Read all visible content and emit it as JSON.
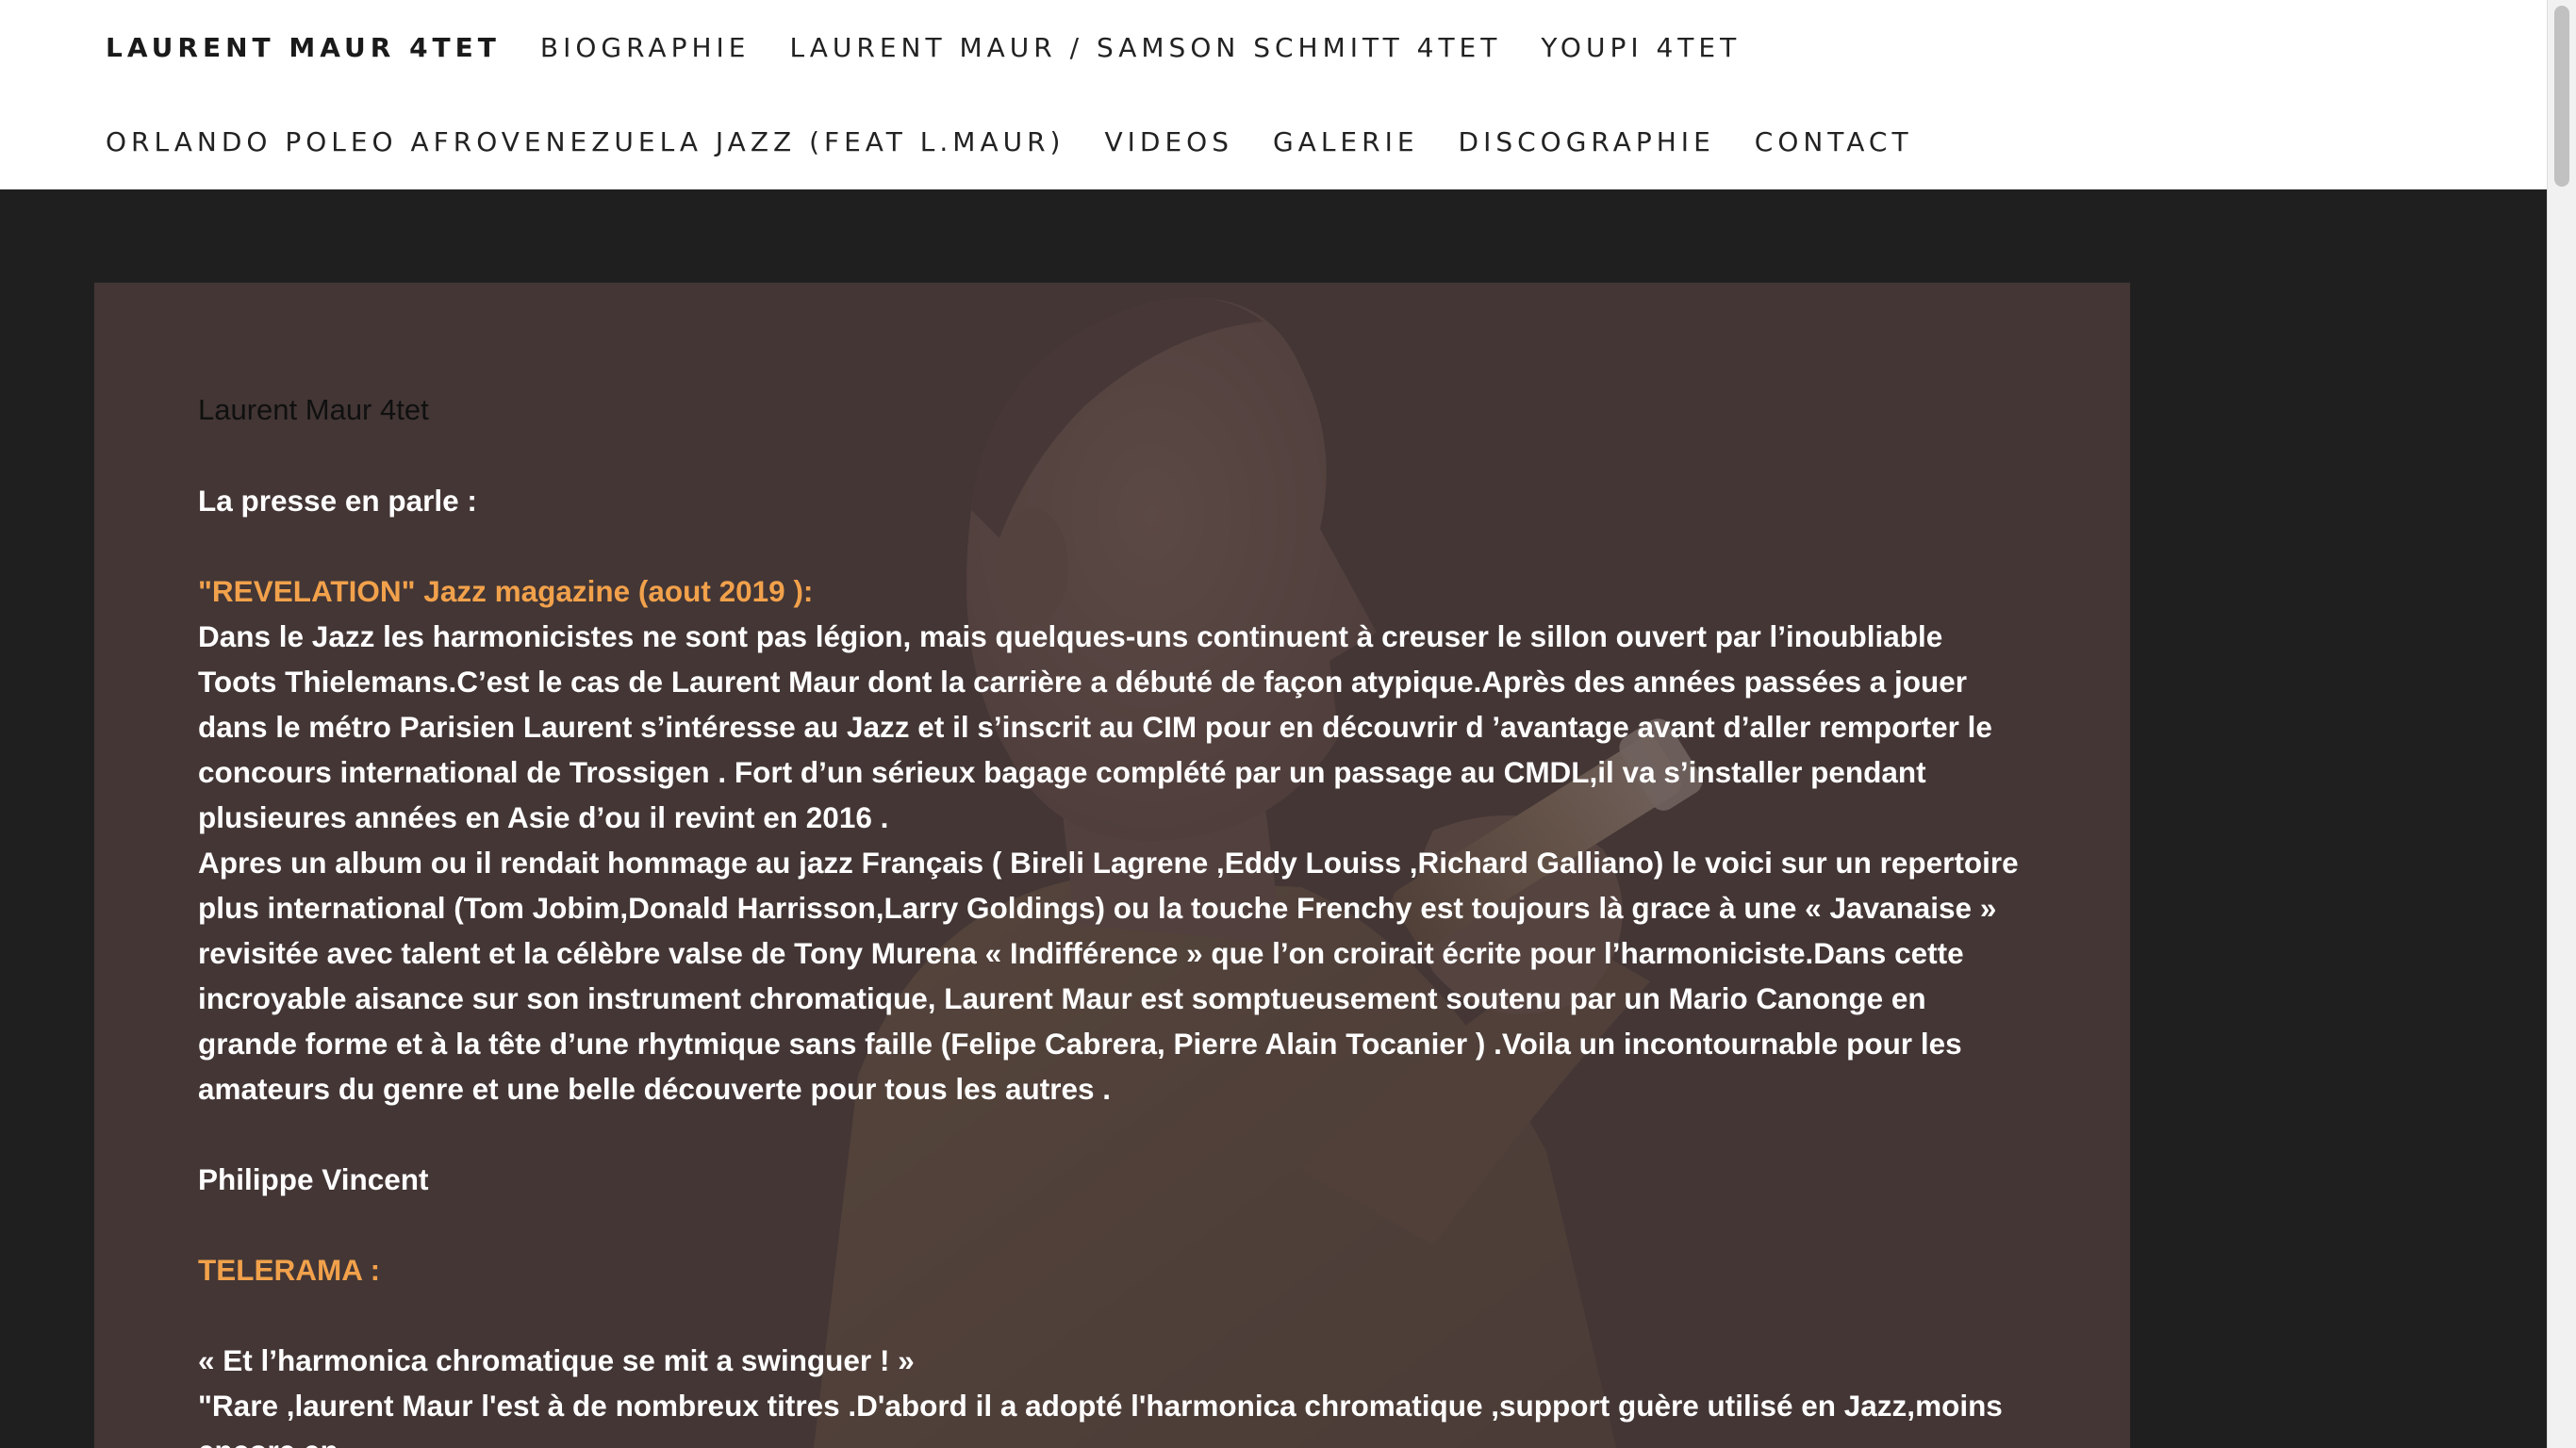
{
  "nav": {
    "row1": [
      "LAURENT MAUR 4TET",
      "BIOGRAPHIE",
      "LAURENT MAUR / SAMSON SCHMITT 4TET",
      "YOUPI 4TET"
    ],
    "row2": [
      "ORLANDO POLEO AFROVENEZUELA JAZZ (FEAT L.MAUR)",
      "VIDEOS",
      "GALERIE",
      "DISCOGRAPHIE",
      "CONTACT"
    ]
  },
  "content": {
    "site_title": "Laurent Maur 4tet",
    "press_heading": "La presse en parle :",
    "review1": {
      "source": "\"REVELATION\" Jazz magazine (aout 2019 ):",
      "paragraph1": "Dans le Jazz les harmonicistes ne sont pas légion, mais quelques-uns continuent à creuser le sillon ouvert par l’inoubliable Toots Thielemans.C’est le cas de Laurent Maur dont la carrière a débuté de façon atypique.Après des années passées a jouer dans le métro Parisien Laurent s’intéresse au Jazz et il s’inscrit au CIM pour en découvrir d ’avantage avant d’aller remporter le concours international de Trossigen . Fort d’un sérieux bagage complété par un passage au CMDL,il va s’installer pendant plusieures années en Asie d’ou il revint en 2016 .",
      "paragraph2": "Apres un album ou il rendait hommage au jazz Français ( Bireli Lagrene ,Eddy Louiss ,Richard Galliano) le voici sur un repertoire plus international (Tom Jobim,Donald Harrisson,Larry Goldings) ou la touche Frenchy est toujours là grace à une « Javanaise » revisitée avec talent et la célèbre valse de Tony Murena « Indifférence » que l’on croirait écrite pour l’harmoniciste.Dans cette incroyable aisance sur son instrument chromatique, Laurent Maur est somptueusement soutenu par un Mario Canonge en grande forme et à la tête d’une rhytmique sans faille (Felipe Cabrera, Pierre Alain Tocanier ) .Voila un incontournable pour les amateurs du genre et une belle découverte pour tous les autres .",
      "author": "Philippe Vincent"
    },
    "review2": {
      "source": "TELERAMA :",
      "quote": "« Et l’harmonica chromatique se mit a swinguer ! »",
      "paragraph1": "\"Rare ,laurent Maur l'est à de nombreux titres .D'abord il a adopté l'harmonica chromatique ,support guère utilisé en Jazz,moins encore en"
    }
  },
  "colors": {
    "accent": "#f2a14b",
    "nav_bg": "#ffffff",
    "page_bg": "#1f1f1f",
    "panel_bg": "#4e3e3c"
  },
  "icons": {
    "hero_image": "harmonica-player-photo"
  }
}
